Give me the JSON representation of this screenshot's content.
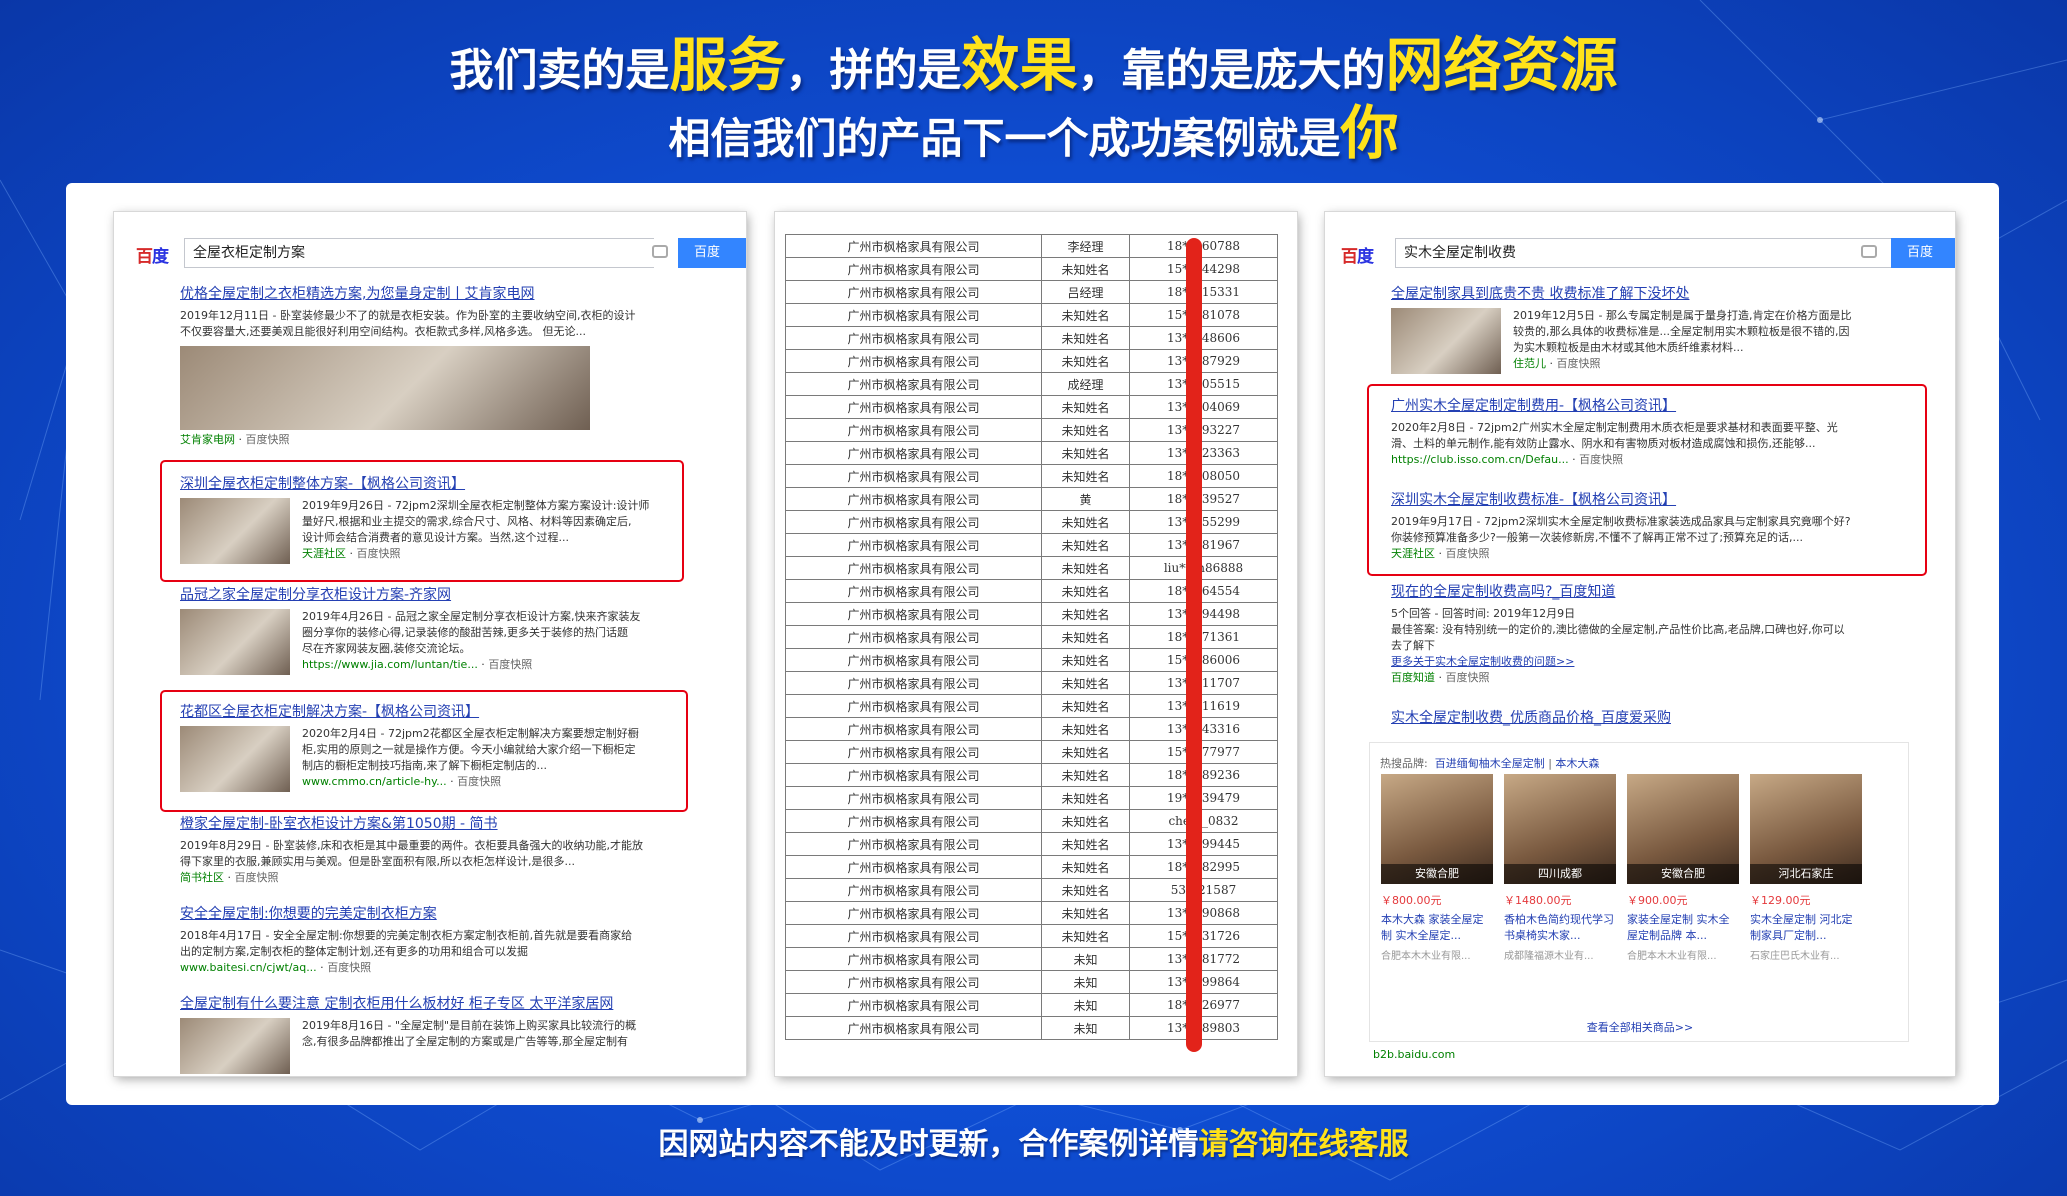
{
  "headline": {
    "line1": [
      {
        "t": "我们卖的是"
      },
      {
        "t": "服务",
        "h": 1
      },
      {
        "t": "，拼的是"
      },
      {
        "t": "效果",
        "h": 1
      },
      {
        "t": "，靠的是庞大的"
      },
      {
        "t": "网络资源",
        "h": 1
      }
    ],
    "line2": [
      {
        "t": "相信我们的产品下一个成功案例就是"
      },
      {
        "t": "你",
        "h": 1
      }
    ]
  },
  "footer": {
    "normal": "因网站内容不能及时更新，合作案例详情",
    "highlight": "请咨询在线客服"
  },
  "panel1": {
    "logo": [
      "百",
      "度"
    ],
    "query": "全屋衣柜定制方案",
    "button": "百度",
    "results": [
      {
        "title": "优格全屋定制之衣柜精选方案,为您量身定制丨艾肯家电网",
        "snippet": [
          "2019年12月11日 - 卧室装修最少不了的就是衣柜安装。作为卧室的主要收纳空间,衣柜的设计",
          "不仅要容量大,还要美观且能很好利用空间结构。衣柜款式多样,风格多选。 但无论..."
        ],
        "source": "艾肯家电网",
        "kuaizhao": "百度快照"
      },
      {
        "title": "深圳全屋衣柜定制整体方案-【枫格公司资讯】",
        "snippet": [
          "2019年9月26日 - 72jpm2深圳全屋衣柜定制整体方案方案设计:设计师",
          "量好尺,根据和业主提交的需求,综合尺寸、风格、材料等因素确定后,",
          "设计师会结合消费者的意见设计方案。当然,这个过程..."
        ],
        "source": "天涯社区",
        "kuaizhao": "百度快照"
      },
      {
        "title": "品冠之家全屋定制分享衣柜设计方案-齐家网",
        "snippet": [
          "2019年4月26日 - 品冠之家全屋定制分享衣柜设计方案,快来齐家装友",
          "圈分享你的装修心得,记录装修的酸甜苦辣,更多关于装修的热门话题",
          "尽在齐家网装友圈,装修交流论坛。"
        ],
        "source": "https://www.jia.com/luntan/tie...",
        "kuaizhao": "百度快照"
      },
      {
        "title": "花都区全屋衣柜定制解决方案-【枫格公司资讯】",
        "snippet": [
          "2020年2月4日 - 72jpm2花都区全屋衣柜定制解决方案要想定制好橱",
          "柜,实用的原则之一就是操作方便。今天小编就给大家介绍一下橱柜定",
          "制店的橱柜定制技巧指南,来了解下橱柜定制店的..."
        ],
        "source": "www.cmmo.cn/article-hy...",
        "kuaizhao": "百度快照"
      },
      {
        "title": "橙家全屋定制-卧室衣柜设计方案&第1050期 - 简书",
        "snippet": [
          "2019年8月29日 - 卧室装修,床和衣柜是其中最重要的两件。衣柜要具备强大的收纳功能,才能放",
          "得下家里的衣服,兼顾实用与美观。但是卧室面积有限,所以衣柜怎样设计,是很多..."
        ],
        "source": "简书社区",
        "kuaizhao": "百度快照"
      },
      {
        "title": "安全全屋定制:你想要的完美定制衣柜方案",
        "snippet": [
          "2018年4月17日 - 安全全屋定制:你想要的完美定制衣柜方案定制衣柜前,首先就是要看商家给",
          "出的定制方案,定制衣柜的整体定制计划,还有更多的功用和组合可以发掘"
        ],
        "source": "www.baitesi.cn/cjwt/aq...",
        "kuaizhao": "百度快照"
      },
      {
        "title": "全屋定制有什么要注意 定制衣柜用什么板材好 柜子专区 太平洋家居网",
        "snippet": [
          "2019年8月16日 - \"全屋定制\"是目前在装饰上购买家具比较流行的概",
          "念,有很多品牌都推出了全屋定制的方案或是广告等等,那全屋定制有"
        ],
        "source": "",
        "kuaizhao": ""
      }
    ]
  },
  "panel2": {
    "company": "广州市枫格家具有限公司",
    "rows": [
      {
        "n": "李经理",
        "p": "18**560788"
      },
      {
        "n": "未知姓名",
        "p": "15**544298"
      },
      {
        "n": "吕经理",
        "p": "18**615331"
      },
      {
        "n": "未知姓名",
        "p": "15**581078"
      },
      {
        "n": "未知姓名",
        "p": "13**048606"
      },
      {
        "n": "未知姓名",
        "p": "13**287929"
      },
      {
        "n": "成经理",
        "p": "13**905515"
      },
      {
        "n": "未知姓名",
        "p": "13**004069"
      },
      {
        "n": "未知姓名",
        "p": "13**493227"
      },
      {
        "n": "未知姓名",
        "p": "13**723363"
      },
      {
        "n": "未知姓名",
        "p": "18**908050"
      },
      {
        "n": "黄",
        "p": "18**339527"
      },
      {
        "n": "未知姓名",
        "p": "13**155299"
      },
      {
        "n": "未知姓名",
        "p": "13**181967"
      },
      {
        "n": "未知姓名",
        "p": "liu***n86888"
      },
      {
        "n": "未知姓名",
        "p": "18**264554"
      },
      {
        "n": "未知姓名",
        "p": "13**894498"
      },
      {
        "n": "未知姓名",
        "p": "18**571361"
      },
      {
        "n": "未知姓名",
        "p": "15**086006"
      },
      {
        "n": "未知姓名",
        "p": "13**811707"
      },
      {
        "n": "未知姓名",
        "p": "13**111619"
      },
      {
        "n": "未知姓名",
        "p": "13**443316"
      },
      {
        "n": "未知姓名",
        "p": "15**177977"
      },
      {
        "n": "未知姓名",
        "p": "18**089236"
      },
      {
        "n": "未知姓名",
        "p": "19**339479"
      },
      {
        "n": "未知姓名",
        "p": "che**_0832"
      },
      {
        "n": "未知姓名",
        "p": "13**099445"
      },
      {
        "n": "未知姓名",
        "p": "18**882995"
      },
      {
        "n": "未知姓名",
        "p": "53**21587"
      },
      {
        "n": "未知姓名",
        "p": "13**190868"
      },
      {
        "n": "未知姓名",
        "p": "15**131726"
      },
      {
        "n": "未知",
        "p": "13**281772"
      },
      {
        "n": "未知",
        "p": "13**999864"
      },
      {
        "n": "未知",
        "p": "18**326977"
      },
      {
        "n": "未知",
        "p": "13**689803"
      }
    ]
  },
  "panel3": {
    "logo": [
      "百",
      "度"
    ],
    "query": "实木全屋定制收费",
    "button": "百度",
    "results": [
      {
        "title": "全屋定制家具到底贵不贵 收费标准了解下没坏处",
        "snippet": [
          "2019年12月5日 - 那么专属定制是属于量身打造,肯定在价格方面是比",
          "较贵的,那么具体的收费标准是...全屋定制用实木颗粒板是很不错的,因",
          "为实木颗粒板是由木材或其他木质纤维素材料..."
        ],
        "source": "住范儿",
        "kuaizhao": "百度快照"
      },
      {
        "title": "广州实木全屋定制定制费用-【枫格公司资讯】",
        "snippet": [
          "2020年2月8日 - 72jpm2广州实木全屋定制定制费用木质衣柜是要求基材和表面要平整、光",
          "滑、土料的单元制作,能有效防止露水、阴水和有害物质对板材造成腐蚀和损伤,还能够..."
        ],
        "source": "https://club.isso.com.cn/Defau...",
        "kuaizhao": "百度快照"
      },
      {
        "title": "深圳实木全屋定制收费标准-【枫格公司资讯】",
        "snippet": [
          "2019年9月17日 - 72jpm2深圳实木全屋定制收费标准家装选成品家具与定制家具究竟哪个好?",
          "你装修预算准备多少?一般第一次装修新房,不懂不了解再正常不过了;预算充足的话,..."
        ],
        "source": "天涯社区",
        "kuaizhao": "百度快照"
      },
      {
        "title": "现在的全屋定制收费高吗?_百度知道",
        "snippet": [
          "5个回答 - 回答时间: 2019年12月9日",
          "最佳答案: 没有特别统一的定价的,澳比德做的全屋定制,产品性价比高,老品牌,口碑也好,你可以",
          "去了解下"
        ],
        "more": "更多关于实木全屋定制收费的问题>>",
        "source": "百度知道",
        "kuaizhao": "百度快照"
      },
      {
        "title": "实木全屋定制收费_优质商品价格_百度爱采购",
        "snippet": [],
        "source": "",
        "kuaizhao": ""
      }
    ],
    "hot_label": "热搜品牌:",
    "hot_brands": [
      "百进缅甸柚木全屋定制",
      "本木大森"
    ],
    "products": [
      {
        "loc": "安徽合肥",
        "price": "￥800.00元",
        "name": "本木大森 家装全屋定制 实木全屋定...",
        "seller": "合肥本木木业有限..."
      },
      {
        "loc": "四川成都",
        "price": "￥1480.00元",
        "name": "香柏木色简约现代学习书桌椅实木家...",
        "seller": "成都隆福源木业有..."
      },
      {
        "loc": "安徽合肥",
        "price": "￥900.00元",
        "name": "家装全屋定制 实木全屋定制品牌 本...",
        "seller": "合肥本木木业有限..."
      },
      {
        "loc": "河北石家庄",
        "price": "￥129.00元",
        "name": "实木全屋定制 河北定制家具厂定制...",
        "seller": "石家庄巴氏木业有..."
      }
    ],
    "view_all": "查看全部相关商品>>",
    "b2b": "b2b.baidu.com"
  },
  "colors": {
    "accent_yellow": "#ffe21a",
    "link_blue": "#2440b3",
    "highlight_red": "#e60012",
    "bg_blue": "#0f4fd6"
  },
  "red_keywords": [
    "全屋定制",
    "衣柜",
    "方案",
    "定制",
    "收费",
    "实木",
    "全屋",
    "费用",
    "收费标准",
    "定制衣柜"
  ]
}
